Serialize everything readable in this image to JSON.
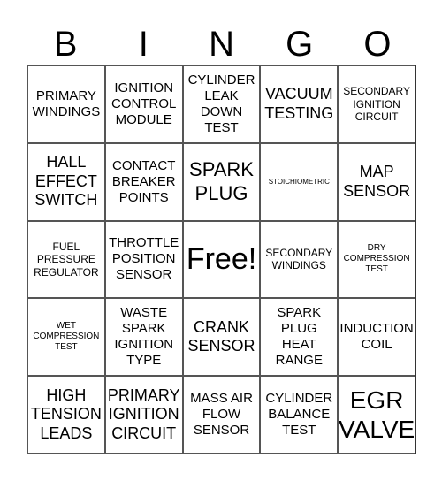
{
  "header": [
    "B",
    "I",
    "N",
    "G",
    "O"
  ],
  "cells": [
    {
      "text": "PRIMARY WINDINGS",
      "size": "s3"
    },
    {
      "text": "IGNITION CONTROL MODULE",
      "size": "s3"
    },
    {
      "text": "CYLINDER LEAK DOWN TEST",
      "size": "s3"
    },
    {
      "text": "VACUUM TESTING",
      "size": "s4"
    },
    {
      "text": "SECONDARY IGNITION CIRCUIT",
      "size": "s2"
    },
    {
      "text": "HALL EFFECT SWITCH",
      "size": "s4"
    },
    {
      "text": "CONTACT BREAKER POINTS",
      "size": "s3"
    },
    {
      "text": "SPARK PLUG",
      "size": "s5"
    },
    {
      "text": "STOICHIOMETRIC",
      "size": "s8"
    },
    {
      "text": "MAP SENSOR",
      "size": "s4"
    },
    {
      "text": "FUEL PRESSURE REGULATOR",
      "size": "s2"
    },
    {
      "text": "THROTTLE POSITION SENSOR",
      "size": "s3"
    },
    {
      "text": "Free!",
      "size": "s7"
    },
    {
      "text": "SECONDARY WINDINGS",
      "size": "s2"
    },
    {
      "text": "DRY COMPRESSION TEST",
      "size": "s1"
    },
    {
      "text": "WET COMPRESSION TEST",
      "size": "s1"
    },
    {
      "text": "WASTE SPARK IGNITION TYPE",
      "size": "s3"
    },
    {
      "text": "CRANK SENSOR",
      "size": "s4"
    },
    {
      "text": "SPARK PLUG HEAT RANGE",
      "size": "s3"
    },
    {
      "text": "INDUCTION COIL",
      "size": "s3"
    },
    {
      "text": "HIGH TENSION LEADS",
      "size": "s4"
    },
    {
      "text": "PRIMARY IGNITION CIRCUIT",
      "size": "s4"
    },
    {
      "text": "MASS AIR FLOW SENSOR",
      "size": "s3"
    },
    {
      "text": "CYLINDER BALANCE TEST",
      "size": "s3"
    },
    {
      "text": "EGR VALVE",
      "size": "s6"
    }
  ]
}
